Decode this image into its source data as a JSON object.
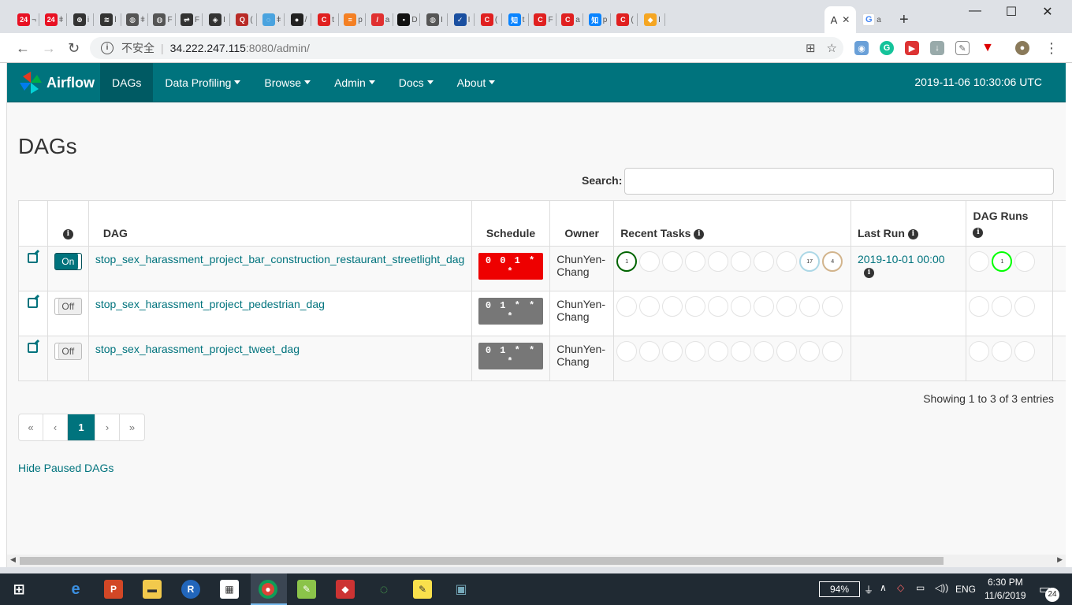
{
  "browser": {
    "tabs": [
      {
        "icon": "24-icon",
        "color": "#e81123",
        "glyph": "24",
        "label": "¬"
      },
      {
        "icon": "24-icon",
        "color": "#e81123",
        "glyph": "24",
        "label": "ǂ"
      },
      {
        "icon": "crosshair-icon",
        "color": "#333333",
        "glyph": "⊕",
        "label": "i"
      },
      {
        "icon": "wifi-icon",
        "color": "#333333",
        "glyph": "≋",
        "label": "l"
      },
      {
        "icon": "globe-icon",
        "color": "#555555",
        "glyph": "◍",
        "label": "ǂ"
      },
      {
        "icon": "globe-icon",
        "color": "#555555",
        "glyph": "◍",
        "label": "F"
      },
      {
        "icon": "network-icon",
        "color": "#333333",
        "glyph": "⇌",
        "label": "F"
      },
      {
        "icon": "diamond-icon",
        "color": "#333333",
        "glyph": "◈",
        "label": "I"
      },
      {
        "icon": "quora-icon",
        "color": "#b92b27",
        "glyph": "Q",
        "label": "("
      },
      {
        "icon": "drop-icon",
        "color": "#4aa3df",
        "glyph": "◌",
        "label": "ǂ"
      },
      {
        "icon": "github-icon",
        "color": "#222222",
        "glyph": "●",
        "label": "/"
      },
      {
        "icon": "c-icon",
        "color": "#e02020",
        "glyph": "C",
        "label": "t"
      },
      {
        "icon": "stackoverflow-icon",
        "color": "#f48024",
        "glyph": "≡",
        "label": "p"
      },
      {
        "icon": "pen-icon",
        "color": "#e03030",
        "glyph": "/",
        "label": "a"
      },
      {
        "icon": "dark-icon",
        "color": "#111111",
        "glyph": "▪",
        "label": "D"
      },
      {
        "icon": "globe-icon",
        "color": "#555555",
        "glyph": "◍",
        "label": "I"
      },
      {
        "icon": "swoosh-icon",
        "color": "#1a4fa0",
        "glyph": "✓",
        "label": "I"
      },
      {
        "icon": "c-icon",
        "color": "#e02020",
        "glyph": "C",
        "label": "("
      },
      {
        "icon": "zhihu-icon",
        "color": "#0a84ff",
        "glyph": "知",
        "label": "t"
      },
      {
        "icon": "c-icon",
        "color": "#e02020",
        "glyph": "C",
        "label": "F"
      },
      {
        "icon": "c-icon",
        "color": "#e02020",
        "glyph": "C",
        "label": "a"
      },
      {
        "icon": "zhihu-icon",
        "color": "#0a84ff",
        "glyph": "知",
        "label": "p"
      },
      {
        "icon": "c-icon",
        "color": "#e02020",
        "glyph": "C",
        "label": "("
      },
      {
        "icon": "box-icon",
        "color": "#f5a623",
        "glyph": "◆",
        "label": "I"
      }
    ],
    "active_tab_label": "A",
    "last_tab": {
      "icon": "google-icon",
      "color": "#4285f4",
      "glyph": "G",
      "label": "a"
    },
    "new_tab": "+",
    "address": {
      "insecure_label": "不安全",
      "host": "34.222.247.115",
      "rest": ":8080/admin/"
    }
  },
  "airflow": {
    "brand": "Airflow",
    "menu": [
      {
        "label": "DAGs",
        "active": true,
        "dropdown": false
      },
      {
        "label": "Data Profiling",
        "active": false,
        "dropdown": true
      },
      {
        "label": "Browse",
        "active": false,
        "dropdown": true
      },
      {
        "label": "Admin",
        "active": false,
        "dropdown": true
      },
      {
        "label": "Docs",
        "active": false,
        "dropdown": true
      },
      {
        "label": "About",
        "active": false,
        "dropdown": true
      }
    ],
    "timestamp": "2019-11-06 10:30:06 UTC",
    "page_title": "DAGs",
    "search_label": "Search:",
    "search_value": "",
    "table": {
      "headers": {
        "info": "i",
        "dag": "DAG",
        "schedule": "Schedule",
        "owner": "Owner",
        "recent_tasks": "Recent Tasks",
        "last_run": "Last Run",
        "dag_runs": "DAG Runs"
      },
      "rows": [
        {
          "toggle": "On",
          "dag_id": "stop_sex_harassment_project_bar_construction_restaurant_streetlight_dag",
          "schedule": "0 0 1 * *",
          "schedule_color": "red",
          "owner": "ChunYen-Chang",
          "recent_tasks": [
            {
              "count": "1",
              "color": "#006400"
            },
            {
              "count": "",
              "color": ""
            },
            {
              "count": "",
              "color": ""
            },
            {
              "count": "",
              "color": ""
            },
            {
              "count": "",
              "color": ""
            },
            {
              "count": "",
              "color": ""
            },
            {
              "count": "",
              "color": ""
            },
            {
              "count": "",
              "color": ""
            },
            {
              "count": "17",
              "color": "#add8e6"
            },
            {
              "count": "4",
              "color": "#d2b48c"
            }
          ],
          "last_run": "2019-10-01 00:00",
          "dag_runs": [
            {
              "count": "",
              "color": ""
            },
            {
              "count": "1",
              "color": "#00ff00"
            },
            {
              "count": "",
              "color": ""
            }
          ]
        },
        {
          "toggle": "Off",
          "dag_id": "stop_sex_harassment_project_pedestrian_dag",
          "schedule": "0 1 * * *",
          "schedule_color": "gray",
          "owner": "ChunYen-Chang",
          "recent_tasks": [
            {
              "count": "",
              "color": ""
            },
            {
              "count": "",
              "color": ""
            },
            {
              "count": "",
              "color": ""
            },
            {
              "count": "",
              "color": ""
            },
            {
              "count": "",
              "color": ""
            },
            {
              "count": "",
              "color": ""
            },
            {
              "count": "",
              "color": ""
            },
            {
              "count": "",
              "color": ""
            },
            {
              "count": "",
              "color": ""
            },
            {
              "count": "",
              "color": ""
            }
          ],
          "last_run": "",
          "dag_runs": [
            {
              "count": "",
              "color": ""
            },
            {
              "count": "",
              "color": ""
            },
            {
              "count": "",
              "color": ""
            }
          ]
        },
        {
          "toggle": "Off",
          "dag_id": "stop_sex_harassment_project_tweet_dag",
          "schedule": "0 1 * * *",
          "schedule_color": "gray",
          "owner": "ChunYen-Chang",
          "recent_tasks": [
            {
              "count": "",
              "color": ""
            },
            {
              "count": "",
              "color": ""
            },
            {
              "count": "",
              "color": ""
            },
            {
              "count": "",
              "color": ""
            },
            {
              "count": "",
              "color": ""
            },
            {
              "count": "",
              "color": ""
            },
            {
              "count": "",
              "color": ""
            },
            {
              "count": "",
              "color": ""
            },
            {
              "count": "",
              "color": ""
            },
            {
              "count": "",
              "color": ""
            }
          ],
          "last_run": "",
          "dag_runs": [
            {
              "count": "",
              "color": ""
            },
            {
              "count": "",
              "color": ""
            },
            {
              "count": "",
              "color": ""
            }
          ]
        }
      ]
    },
    "showing": "Showing 1 to 3 of 3 entries",
    "pagination": [
      "«",
      "‹",
      "1",
      "›",
      "»"
    ],
    "pagination_active": "1",
    "hide_paused": "Hide Paused DAGs"
  },
  "taskbar": {
    "battery": "94%",
    "language": "ENG",
    "time": "6:30 PM",
    "date": "11/6/2019",
    "notifications": "24"
  },
  "colors": {
    "airflow_teal": "#00737d",
    "success": "#006400",
    "running": "#00ff00"
  }
}
